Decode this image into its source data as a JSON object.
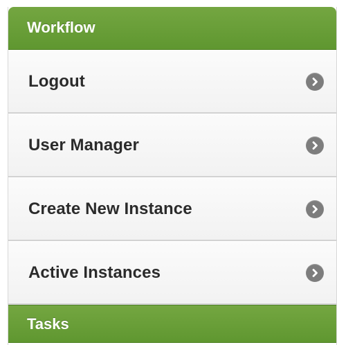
{
  "sections": {
    "workflow": {
      "title": "Workflow",
      "items": [
        {
          "label": "Logout",
          "icon": "chevron-right-icon"
        },
        {
          "label": "User Manager",
          "icon": "chevron-right-icon"
        },
        {
          "label": "Create New Instance",
          "icon": "chevron-right-icon"
        },
        {
          "label": "Active Instances",
          "icon": "chevron-right-icon"
        }
      ]
    },
    "tasks": {
      "title": "Tasks"
    }
  },
  "colors": {
    "header_green": "#6a9f38",
    "item_text": "#2b2b2b",
    "icon_gray": "#7d7d7d"
  }
}
